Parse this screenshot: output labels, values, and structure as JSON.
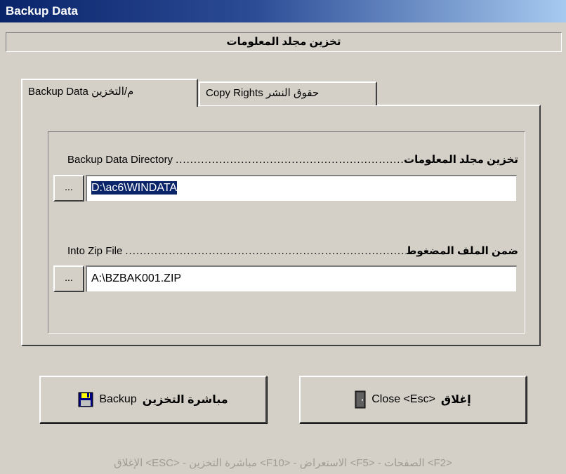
{
  "window": {
    "title": "Backup Data"
  },
  "header": {
    "subtitle": "تخزين مجلد المعلومات"
  },
  "tabs": [
    {
      "label": "Backup Data  م/التخزين",
      "active": true
    },
    {
      "label": "Copy Rights  حقوق النشر",
      "active": false
    }
  ],
  "fields": {
    "directory": {
      "label_en": "Backup Data Directory",
      "label_ar": "تخزين مجلد المعلومات",
      "browse_label": "...",
      "value": "D:\\ac6\\WINDATA"
    },
    "zip": {
      "label_en": "Into Zip File",
      "label_ar": "ضمن الملف المضغوط",
      "browse_label": "...",
      "value": "A:\\BZBAK001.ZIP"
    }
  },
  "buttons": {
    "backup": {
      "en": "Backup",
      "ar": "مباشرة التخزين",
      "icon": "floppy-disk-icon"
    },
    "close": {
      "en": "Close <Esc>",
      "ar": "إغلاق",
      "icon": "door-icon"
    }
  },
  "status": {
    "text": "<F2> الصفحات - <F5> الاستعراض - <F10> مباشرة التخزين - <ESC> الإغلاق"
  },
  "colors": {
    "face": "#d4d0c8",
    "title_start": "#0a246a",
    "title_end": "#a6caf0",
    "selection": "#0a246a",
    "status_text": "#a09c94"
  }
}
